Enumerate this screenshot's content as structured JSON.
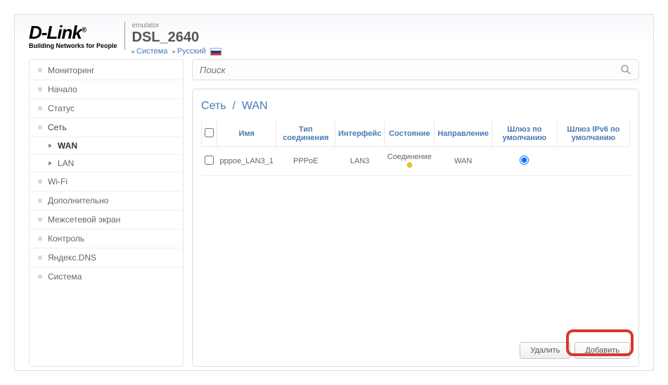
{
  "header": {
    "brand": "D-Link",
    "brand_suffix": "®",
    "tagline": "Building Networks for People",
    "emulator_label": "emulator",
    "model": "DSL_2640",
    "breadcrumb_system": "Система",
    "breadcrumb_lang": "Русский"
  },
  "sidebar": {
    "items": [
      {
        "label": "Мониторинг"
      },
      {
        "label": "Начало"
      },
      {
        "label": "Статус"
      },
      {
        "label": "Сеть",
        "expanded": true,
        "children": [
          {
            "label": "WAN",
            "active": true
          },
          {
            "label": "LAN"
          }
        ]
      },
      {
        "label": "Wi-Fi"
      },
      {
        "label": "Дополнительно"
      },
      {
        "label": "Межсетевой экран"
      },
      {
        "label": "Контроль"
      },
      {
        "label": "Яндекс.DNS"
      },
      {
        "label": "Система"
      }
    ]
  },
  "search": {
    "placeholder": "Поиск"
  },
  "panel": {
    "title_root": "Сеть",
    "title_sep": "/",
    "title_leaf": "WAN",
    "columns": {
      "name": "Имя",
      "type": "Тип соединения",
      "iface": "Интерфейс",
      "state": "Состояние",
      "direction": "Направление",
      "gw": "Шлюз по умолчанию",
      "gw6": "Шлюз IPv6 по умолчанию"
    },
    "rows": [
      {
        "name": "pppoe_LAN3_1",
        "type": "PPPoE",
        "iface": "LAN3",
        "state": "Соединение",
        "direction": "WAN"
      }
    ],
    "buttons": {
      "delete": "Удалить",
      "add": "Добавить"
    }
  }
}
